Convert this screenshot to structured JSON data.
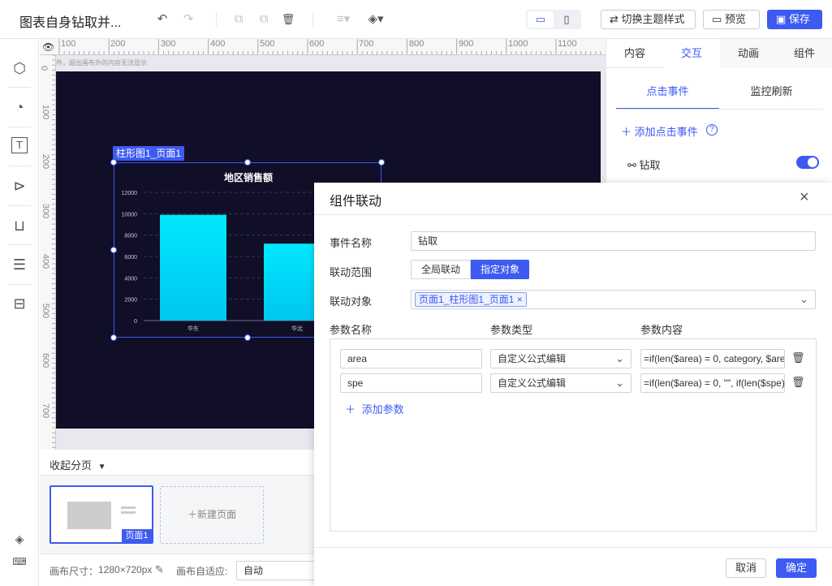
{
  "app": {
    "title": "图表自身钻取并..."
  },
  "toolbar": {
    "undo_icon": "↶",
    "redo_icon": "↷",
    "copy_icon": "⧉",
    "paste_icon": "⧉",
    "delete_icon": "🗑",
    "align_icon": "≡▾",
    "layer_icon": "◈▾",
    "desktop_icon": "▭",
    "mobile_icon": "▯",
    "theme_label": "切换主题样式",
    "preview_label": "预览",
    "save_label": "保存",
    "theme_icon": "⇄",
    "preview_icon": "▭",
    "save_icon": "▣"
  },
  "left_rail": {
    "items": [
      "cube-icon",
      "pie-icon",
      "text-icon",
      "video-icon",
      "inbox-icon",
      "server-icon",
      "archive-icon"
    ],
    "bottom": [
      "layers-icon",
      "keyboard-icon"
    ]
  },
  "canvas": {
    "hint": "件，超出画布外的内容无法显示",
    "ruler_h": [
      "100",
      "200",
      "300",
      "400",
      "500",
      "600",
      "700",
      "800",
      "900",
      "1000",
      "1100"
    ],
    "ruler_v": [
      "0",
      "100",
      "200",
      "300",
      "400",
      "500",
      "600",
      "700"
    ]
  },
  "component": {
    "label": "柱形图1_页面1"
  },
  "chart_data": {
    "type": "bar",
    "title": "地区销售额",
    "categories": [
      "华东",
      "华北"
    ],
    "values": [
      9900,
      7200
    ],
    "yticks": [
      "12000",
      "10000",
      "8000",
      "6000",
      "4000",
      "2000",
      "0"
    ],
    "ylim": [
      0,
      12000
    ],
    "color": "#00e5ff"
  },
  "pager": {
    "collapse_label": "收起分页",
    "page_name": "页面1",
    "new_page_label": "新建页面"
  },
  "statusbar": {
    "size_label": "画布尺寸：",
    "size_value": "1280×720px",
    "fit_label": "画布自适应:",
    "fit_value": "自动"
  },
  "right_panel": {
    "tabs": [
      "内容",
      "交互",
      "动画",
      "组件"
    ],
    "active_tab": "交互",
    "subtabs": [
      "点击事件",
      "监控刷新"
    ],
    "add_event_label": "添加点击事件",
    "drill_label": "钻取"
  },
  "dialog": {
    "title": "组件联动",
    "event_name_label": "事件名称",
    "event_name_value": "钻取",
    "scope_label": "联动范围",
    "scope_options": [
      "全局联动",
      "指定对象"
    ],
    "target_label": "联动对象",
    "target_tag": "页面1_柱形图1_页面1",
    "col_param_name": "参数名称",
    "col_param_type": "参数类型",
    "col_param_content": "参数内容",
    "params": [
      {
        "name": "area",
        "type": "自定义公式编辑",
        "content": "=if(len($area) = 0, category, $are"
      },
      {
        "name": "spe",
        "type": "自定义公式编辑",
        "content": "=if(len($area) = 0, \"\", if(len($spe)"
      }
    ],
    "add_param_label": "添加参数",
    "cancel_label": "取消",
    "ok_label": "确定"
  }
}
